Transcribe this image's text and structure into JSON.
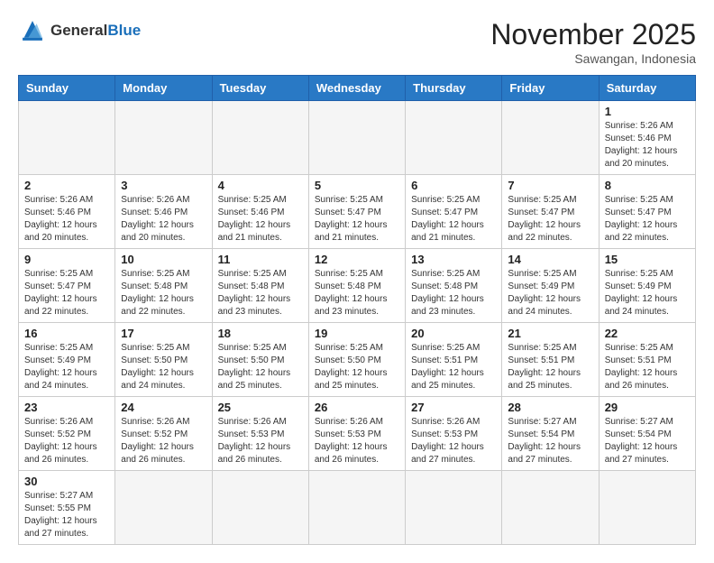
{
  "header": {
    "logo_general": "General",
    "logo_blue": "Blue",
    "month": "November 2025",
    "location": "Sawangan, Indonesia"
  },
  "weekdays": [
    "Sunday",
    "Monday",
    "Tuesday",
    "Wednesday",
    "Thursday",
    "Friday",
    "Saturday"
  ],
  "weeks": [
    [
      {
        "day": "",
        "info": ""
      },
      {
        "day": "",
        "info": ""
      },
      {
        "day": "",
        "info": ""
      },
      {
        "day": "",
        "info": ""
      },
      {
        "day": "",
        "info": ""
      },
      {
        "day": "",
        "info": ""
      },
      {
        "day": "1",
        "info": "Sunrise: 5:26 AM\nSunset: 5:46 PM\nDaylight: 12 hours and 20 minutes."
      }
    ],
    [
      {
        "day": "2",
        "info": "Sunrise: 5:26 AM\nSunset: 5:46 PM\nDaylight: 12 hours and 20 minutes."
      },
      {
        "day": "3",
        "info": "Sunrise: 5:26 AM\nSunset: 5:46 PM\nDaylight: 12 hours and 20 minutes."
      },
      {
        "day": "4",
        "info": "Sunrise: 5:25 AM\nSunset: 5:46 PM\nDaylight: 12 hours and 21 minutes."
      },
      {
        "day": "5",
        "info": "Sunrise: 5:25 AM\nSunset: 5:47 PM\nDaylight: 12 hours and 21 minutes."
      },
      {
        "day": "6",
        "info": "Sunrise: 5:25 AM\nSunset: 5:47 PM\nDaylight: 12 hours and 21 minutes."
      },
      {
        "day": "7",
        "info": "Sunrise: 5:25 AM\nSunset: 5:47 PM\nDaylight: 12 hours and 22 minutes."
      },
      {
        "day": "8",
        "info": "Sunrise: 5:25 AM\nSunset: 5:47 PM\nDaylight: 12 hours and 22 minutes."
      }
    ],
    [
      {
        "day": "9",
        "info": "Sunrise: 5:25 AM\nSunset: 5:47 PM\nDaylight: 12 hours and 22 minutes."
      },
      {
        "day": "10",
        "info": "Sunrise: 5:25 AM\nSunset: 5:48 PM\nDaylight: 12 hours and 22 minutes."
      },
      {
        "day": "11",
        "info": "Sunrise: 5:25 AM\nSunset: 5:48 PM\nDaylight: 12 hours and 23 minutes."
      },
      {
        "day": "12",
        "info": "Sunrise: 5:25 AM\nSunset: 5:48 PM\nDaylight: 12 hours and 23 minutes."
      },
      {
        "day": "13",
        "info": "Sunrise: 5:25 AM\nSunset: 5:48 PM\nDaylight: 12 hours and 23 minutes."
      },
      {
        "day": "14",
        "info": "Sunrise: 5:25 AM\nSunset: 5:49 PM\nDaylight: 12 hours and 24 minutes."
      },
      {
        "day": "15",
        "info": "Sunrise: 5:25 AM\nSunset: 5:49 PM\nDaylight: 12 hours and 24 minutes."
      }
    ],
    [
      {
        "day": "16",
        "info": "Sunrise: 5:25 AM\nSunset: 5:49 PM\nDaylight: 12 hours and 24 minutes."
      },
      {
        "day": "17",
        "info": "Sunrise: 5:25 AM\nSunset: 5:50 PM\nDaylight: 12 hours and 24 minutes."
      },
      {
        "day": "18",
        "info": "Sunrise: 5:25 AM\nSunset: 5:50 PM\nDaylight: 12 hours and 25 minutes."
      },
      {
        "day": "19",
        "info": "Sunrise: 5:25 AM\nSunset: 5:50 PM\nDaylight: 12 hours and 25 minutes."
      },
      {
        "day": "20",
        "info": "Sunrise: 5:25 AM\nSunset: 5:51 PM\nDaylight: 12 hours and 25 minutes."
      },
      {
        "day": "21",
        "info": "Sunrise: 5:25 AM\nSunset: 5:51 PM\nDaylight: 12 hours and 25 minutes."
      },
      {
        "day": "22",
        "info": "Sunrise: 5:25 AM\nSunset: 5:51 PM\nDaylight: 12 hours and 26 minutes."
      }
    ],
    [
      {
        "day": "23",
        "info": "Sunrise: 5:26 AM\nSunset: 5:52 PM\nDaylight: 12 hours and 26 minutes."
      },
      {
        "day": "24",
        "info": "Sunrise: 5:26 AM\nSunset: 5:52 PM\nDaylight: 12 hours and 26 minutes."
      },
      {
        "day": "25",
        "info": "Sunrise: 5:26 AM\nSunset: 5:53 PM\nDaylight: 12 hours and 26 minutes."
      },
      {
        "day": "26",
        "info": "Sunrise: 5:26 AM\nSunset: 5:53 PM\nDaylight: 12 hours and 26 minutes."
      },
      {
        "day": "27",
        "info": "Sunrise: 5:26 AM\nSunset: 5:53 PM\nDaylight: 12 hours and 27 minutes."
      },
      {
        "day": "28",
        "info": "Sunrise: 5:27 AM\nSunset: 5:54 PM\nDaylight: 12 hours and 27 minutes."
      },
      {
        "day": "29",
        "info": "Sunrise: 5:27 AM\nSunset: 5:54 PM\nDaylight: 12 hours and 27 minutes."
      }
    ],
    [
      {
        "day": "30",
        "info": "Sunrise: 5:27 AM\nSunset: 5:55 PM\nDaylight: 12 hours and 27 minutes."
      },
      {
        "day": "",
        "info": ""
      },
      {
        "day": "",
        "info": ""
      },
      {
        "day": "",
        "info": ""
      },
      {
        "day": "",
        "info": ""
      },
      {
        "day": "",
        "info": ""
      },
      {
        "day": "",
        "info": ""
      }
    ]
  ]
}
